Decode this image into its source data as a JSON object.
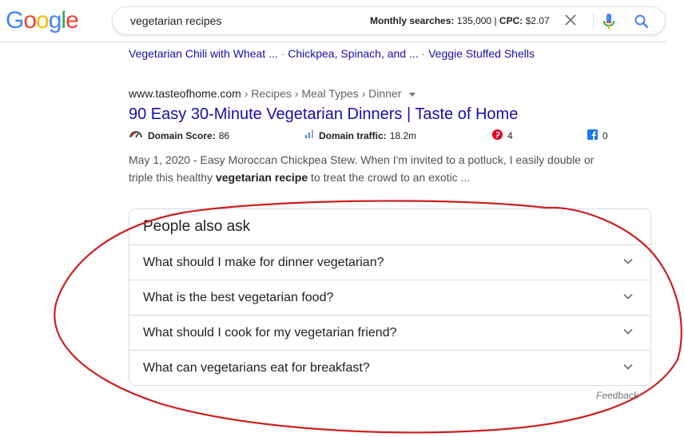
{
  "logo": {
    "letters": [
      "G",
      "o",
      "o",
      "g",
      "l",
      "e"
    ],
    "colors": [
      "#4285F4",
      "#EA4335",
      "#FBBC05",
      "#4285F4",
      "#34A853",
      "#EA4335"
    ]
  },
  "search": {
    "query": "vegetarian recipes",
    "monthly_label": "Monthly searches:",
    "monthly_value": "135,000",
    "cpc_label": "CPC:",
    "cpc_value": "$2.07",
    "separator": "|"
  },
  "sitelinks": [
    "Vegetarian Chili with Wheat ...",
    "Chickpea, Spinach, and ...",
    "Veggie Stuffed Shells"
  ],
  "sitelink_separator": "·",
  "result": {
    "domain": "www.tasteofhome.com",
    "breadcrumbs": [
      "Recipes",
      "Meal Types",
      "Dinner"
    ],
    "crumb_separator": "›",
    "title": "90 Easy 30-Minute Vegetarian Dinners | Taste of Home",
    "domain_score_label": "Domain Score:",
    "domain_score_value": "86",
    "domain_traffic_label": "Domain traffic:",
    "domain_traffic_value": "18.2m",
    "pinterest_count": "4",
    "facebook_count": "0",
    "snippet_date": "May 1, 2020",
    "snippet_dash": " - ",
    "snippet_part1": "Easy Moroccan Chickpea Stew. When I'm invited to a potluck, I easily double or triple this healthy ",
    "snippet_bold": "vegetarian recipe",
    "snippet_part2": " to treat the crowd to an exotic ..."
  },
  "paa": {
    "title": "People also ask",
    "questions": [
      "What should I make for dinner vegetarian?",
      "What is the best vegetarian food?",
      "What should I cook for my vegetarian friend?",
      "What can vegetarians eat for breakfast?"
    ],
    "feedback": "Feedback"
  },
  "icons": {
    "clear": "close-icon",
    "mic": "mic-icon",
    "search": "search-icon",
    "expand": "chevron-down-icon",
    "gauge": "gauge-icon",
    "traffic": "bar-chart-icon",
    "pinterest": "pinterest-icon",
    "facebook": "facebook-icon"
  },
  "colors": {
    "link": "#1a0dab",
    "annotation": "#cc1f1f",
    "pinterest": "#e60023",
    "facebook": "#1877f2",
    "mic_blue": "#4285f4",
    "mic_red": "#ea4335"
  }
}
